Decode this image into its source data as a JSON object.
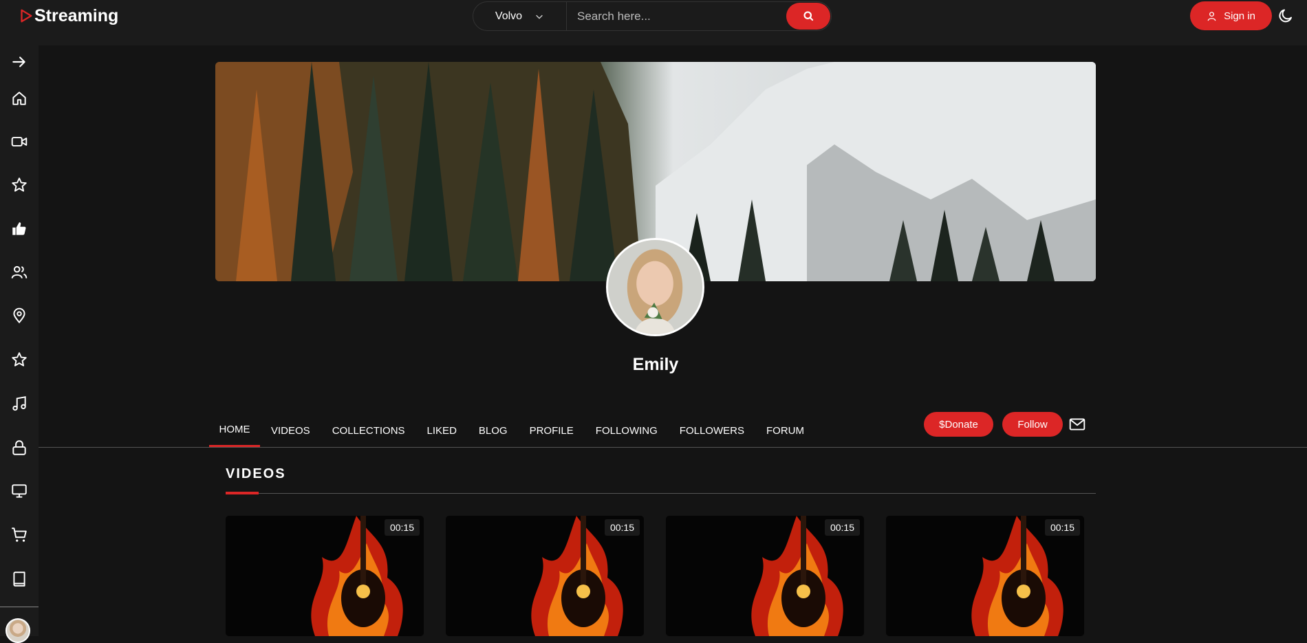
{
  "app": {
    "title": "Streaming"
  },
  "search": {
    "category": "Volvo",
    "placeholder": "Search here...",
    "value": ""
  },
  "header": {
    "signin_label": "Sign in"
  },
  "sidebar": {
    "icons": [
      "arrow-right-icon",
      "home-icon",
      "video-camera-icon",
      "star-icon",
      "thumbs-up-icon",
      "users-icon",
      "location-pin-icon",
      "star-icon",
      "music-note-icon",
      "lock-icon",
      "monitor-icon",
      "cart-icon",
      "book-icon"
    ]
  },
  "profile": {
    "name": "Emily",
    "donate_label": "$Donate",
    "follow_label": "Follow"
  },
  "tabs": [
    "HOME",
    "VIDEOS",
    "COLLECTIONS",
    "LIKED",
    "BLOG",
    "PROFILE",
    "FOLLOWING",
    "FOLLOWERS",
    "FORUM"
  ],
  "active_tab": "HOME",
  "videos_section": {
    "title": "VIDEOS",
    "items": [
      {
        "duration": "00:15"
      },
      {
        "duration": "00:15"
      },
      {
        "duration": "00:15"
      },
      {
        "duration": "00:15"
      }
    ]
  },
  "colors": {
    "accent": "#dc2626",
    "background": "#141414",
    "panel": "#1b1b1b"
  }
}
